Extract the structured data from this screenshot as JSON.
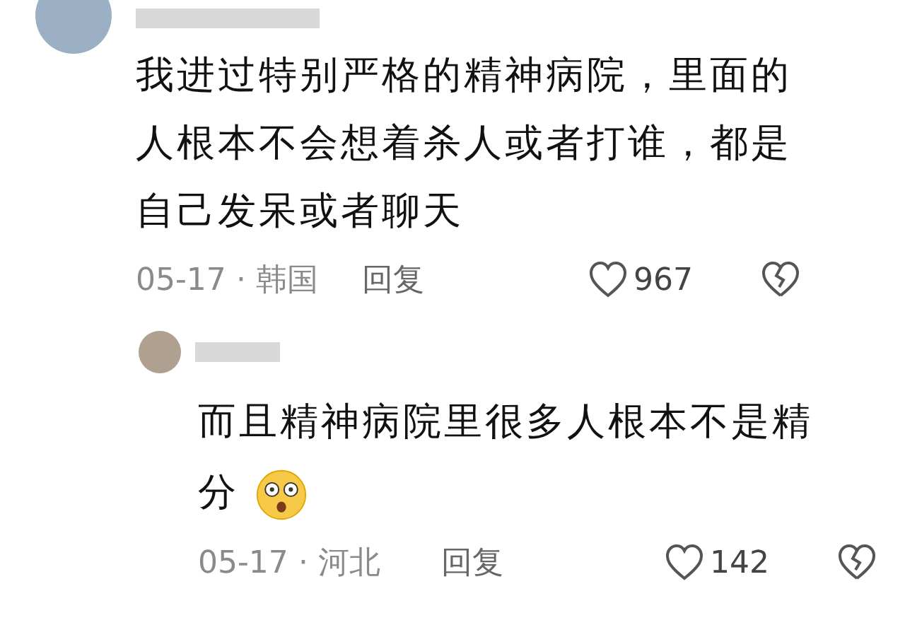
{
  "comment": {
    "text": "我进过特别严格的精神病院，里面的人根本不会想着杀人或者打谁，都是自己发呆或者聊天",
    "date": "05-17",
    "separator": "·",
    "location": "韩国",
    "reply_label": "回复",
    "likes": "967"
  },
  "reply": {
    "text": "而且精神病院里很多人根本不是精分",
    "date": "05-17",
    "separator": "·",
    "location": "河北",
    "reply_label": "回复",
    "likes": "142"
  }
}
